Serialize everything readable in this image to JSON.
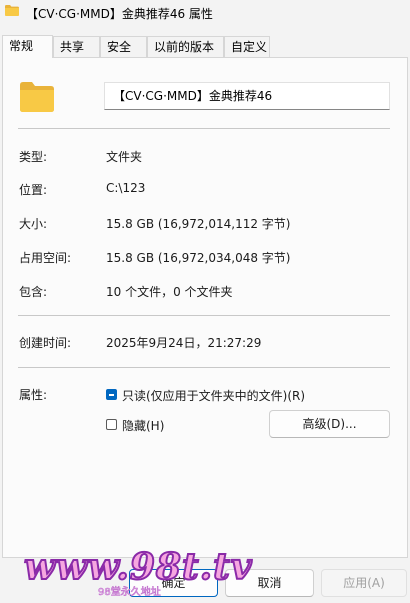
{
  "window": {
    "title": "【CV·CG·MMD】金典推荐46 属性"
  },
  "tabs": [
    {
      "label": "常规",
      "active": true
    },
    {
      "label": "共享"
    },
    {
      "label": "安全"
    },
    {
      "label": "以前的版本"
    },
    {
      "label": "自定义"
    }
  ],
  "general": {
    "name": "【CV·CG·MMD】金典推荐46",
    "rows": [
      {
        "label": "类型:",
        "value": "文件夹"
      },
      {
        "label": "位置:",
        "value": "C:\\123"
      },
      {
        "label": "大小:",
        "value": "15.8 GB (16,972,014,112 字节)"
      },
      {
        "label": "占用空间:",
        "value": "15.8 GB (16,972,034,048 字节)"
      },
      {
        "label": "包含:",
        "value": "10 个文件，0 个文件夹"
      }
    ],
    "created_label": "创建时间:",
    "created_value": "2025年9月24日，21:27:29",
    "attributes_label": "属性:",
    "readonly_label": "只读(仅应用于文件夹中的文件)(R)",
    "readonly_state": "indeterminate",
    "hidden_label": "隐藏(H)",
    "hidden_checked": false,
    "advanced_button": "高级(D)..."
  },
  "footer": {
    "ok": "确定",
    "cancel": "取消",
    "apply": "应用(A)"
  },
  "watermark": {
    "text": "www.98t.tv",
    "sub": "98堂永久地址"
  },
  "colors": {
    "accent": "#0067c0",
    "folder": "#f8c945"
  },
  "icons": {
    "title": "folder-icon",
    "main": "folder-icon"
  }
}
